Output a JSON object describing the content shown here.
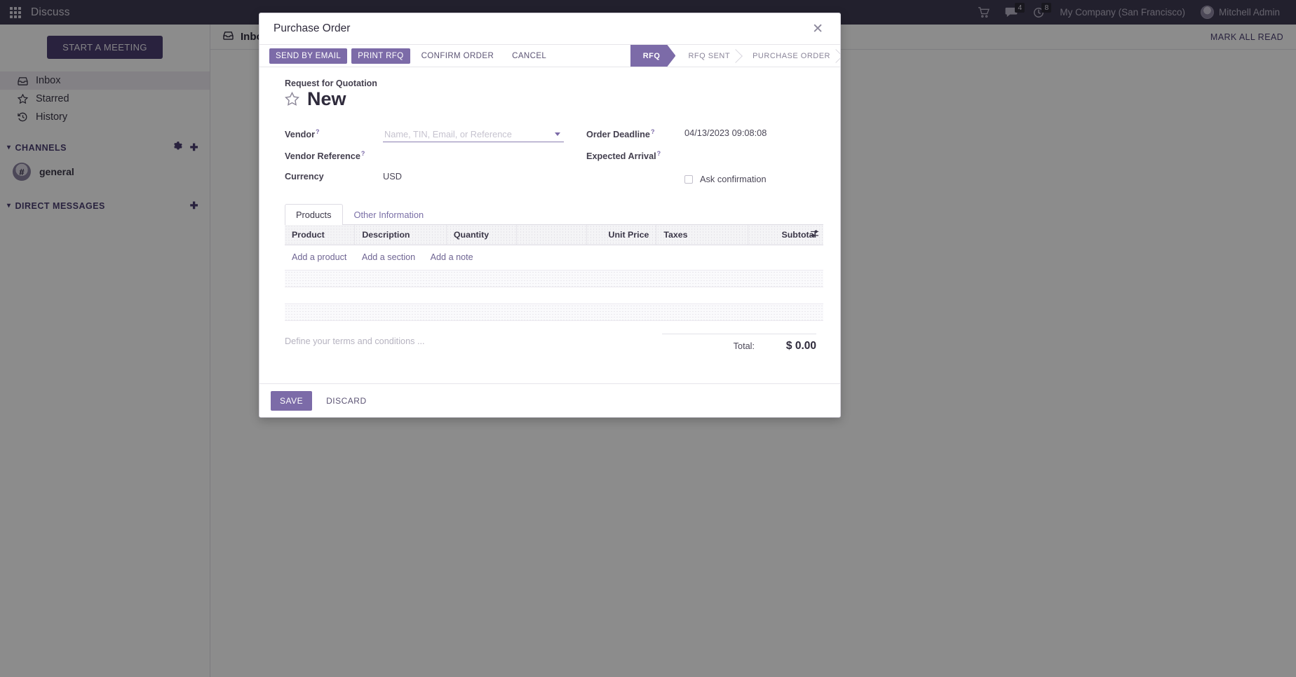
{
  "topbar": {
    "apps_icon": "apps-grid-icon",
    "app_title": "Discuss",
    "cart_icon": "shopping-cart-icon",
    "messages_icon": "messages-icon",
    "messages_count": "4",
    "activities_icon": "activity-clock-icon",
    "activities_count": "8",
    "company": "My Company (San Francisco)",
    "user": "Mitchell Admin"
  },
  "sidebar": {
    "start_meeting": "START A MEETING",
    "mailboxes": [
      {
        "label": "Inbox",
        "icon": "inbox-icon"
      },
      {
        "label": "Starred",
        "icon": "star-icon"
      },
      {
        "label": "History",
        "icon": "history-icon"
      }
    ],
    "channels_title": "CHANNELS",
    "channels_gear_icon": "gear-icon",
    "channels_add_icon": "plus-icon",
    "channels": [
      {
        "name": "general",
        "icon": "hash-icon"
      }
    ],
    "dm_title": "DIRECT MESSAGES",
    "dm_add_icon": "plus-icon"
  },
  "thread": {
    "title": "Inbox",
    "title_icon": "inbox-icon",
    "mark_all_read": "MARK ALL READ"
  },
  "modal": {
    "title": "Purchase Order",
    "close_icon": "close-icon",
    "actions": [
      {
        "label": "SEND BY EMAIL",
        "style": "primary"
      },
      {
        "label": "PRINT RFQ",
        "style": "primary"
      },
      {
        "label": "CONFIRM ORDER",
        "style": "link"
      },
      {
        "label": "CANCEL",
        "style": "link"
      }
    ],
    "statuses": [
      {
        "label": "RFQ",
        "active": true
      },
      {
        "label": "RFQ SENT",
        "active": false
      },
      {
        "label": "PURCHASE ORDER",
        "active": false
      }
    ],
    "record_subtitle": "Request for Quotation",
    "record_title": "New",
    "favorite_icon": "star-outline-icon",
    "fields": {
      "vendor_label": "Vendor",
      "vendor_value": "",
      "vendor_placeholder": "Name, TIN, Email, or Reference",
      "vendor_caret_icon": "chevron-down-icon",
      "vendor_reference_label": "Vendor Reference",
      "vendor_reference_value": "",
      "currency_label": "Currency",
      "currency_value": "USD",
      "order_deadline_label": "Order Deadline",
      "order_deadline_value": "04/13/2023 09:08:08",
      "expected_arrival_label": "Expected Arrival",
      "expected_arrival_value": "",
      "ask_confirmation_label": "Ask confirmation",
      "ask_confirmation_checked": false,
      "help_marker": "?"
    },
    "tabs": [
      {
        "label": "Products",
        "active": true
      },
      {
        "label": "Other Information",
        "active": false
      }
    ],
    "table": {
      "columns": [
        "Product",
        "Description",
        "Quantity",
        "Unit Price",
        "Taxes",
        "Subtotal"
      ],
      "rows": [],
      "optional_columns_icon": "sliders-icon"
    },
    "add_links": [
      "Add a product",
      "Add a section",
      "Add a note"
    ],
    "terms_placeholder": "Define your terms and conditions ...",
    "total_label": "Total:",
    "total_value": "$ 0.00",
    "footer": {
      "save_label": "SAVE",
      "discard_label": "DISCARD"
    }
  },
  "colors": {
    "brand_purple": "#7c6ba8",
    "topbar": "#3f3b53",
    "accent_link": "#6f6593"
  }
}
